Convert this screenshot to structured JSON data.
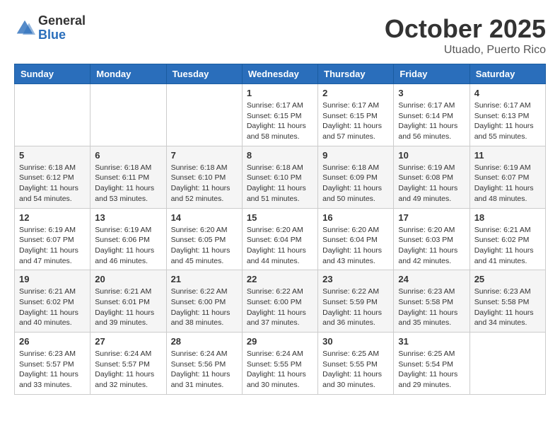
{
  "logo": {
    "general": "General",
    "blue": "Blue"
  },
  "title": "October 2025",
  "location": "Utuado, Puerto Rico",
  "days_of_week": [
    "Sunday",
    "Monday",
    "Tuesday",
    "Wednesday",
    "Thursday",
    "Friday",
    "Saturday"
  ],
  "weeks": [
    [
      {
        "day": "",
        "info": ""
      },
      {
        "day": "",
        "info": ""
      },
      {
        "day": "",
        "info": ""
      },
      {
        "day": "1",
        "info": "Sunrise: 6:17 AM\nSunset: 6:15 PM\nDaylight: 11 hours\nand 58 minutes."
      },
      {
        "day": "2",
        "info": "Sunrise: 6:17 AM\nSunset: 6:15 PM\nDaylight: 11 hours\nand 57 minutes."
      },
      {
        "day": "3",
        "info": "Sunrise: 6:17 AM\nSunset: 6:14 PM\nDaylight: 11 hours\nand 56 minutes."
      },
      {
        "day": "4",
        "info": "Sunrise: 6:17 AM\nSunset: 6:13 PM\nDaylight: 11 hours\nand 55 minutes."
      }
    ],
    [
      {
        "day": "5",
        "info": "Sunrise: 6:18 AM\nSunset: 6:12 PM\nDaylight: 11 hours\nand 54 minutes."
      },
      {
        "day": "6",
        "info": "Sunrise: 6:18 AM\nSunset: 6:11 PM\nDaylight: 11 hours\nand 53 minutes."
      },
      {
        "day": "7",
        "info": "Sunrise: 6:18 AM\nSunset: 6:10 PM\nDaylight: 11 hours\nand 52 minutes."
      },
      {
        "day": "8",
        "info": "Sunrise: 6:18 AM\nSunset: 6:10 PM\nDaylight: 11 hours\nand 51 minutes."
      },
      {
        "day": "9",
        "info": "Sunrise: 6:18 AM\nSunset: 6:09 PM\nDaylight: 11 hours\nand 50 minutes."
      },
      {
        "day": "10",
        "info": "Sunrise: 6:19 AM\nSunset: 6:08 PM\nDaylight: 11 hours\nand 49 minutes."
      },
      {
        "day": "11",
        "info": "Sunrise: 6:19 AM\nSunset: 6:07 PM\nDaylight: 11 hours\nand 48 minutes."
      }
    ],
    [
      {
        "day": "12",
        "info": "Sunrise: 6:19 AM\nSunset: 6:07 PM\nDaylight: 11 hours\nand 47 minutes."
      },
      {
        "day": "13",
        "info": "Sunrise: 6:19 AM\nSunset: 6:06 PM\nDaylight: 11 hours\nand 46 minutes."
      },
      {
        "day": "14",
        "info": "Sunrise: 6:20 AM\nSunset: 6:05 PM\nDaylight: 11 hours\nand 45 minutes."
      },
      {
        "day": "15",
        "info": "Sunrise: 6:20 AM\nSunset: 6:04 PM\nDaylight: 11 hours\nand 44 minutes."
      },
      {
        "day": "16",
        "info": "Sunrise: 6:20 AM\nSunset: 6:04 PM\nDaylight: 11 hours\nand 43 minutes."
      },
      {
        "day": "17",
        "info": "Sunrise: 6:20 AM\nSunset: 6:03 PM\nDaylight: 11 hours\nand 42 minutes."
      },
      {
        "day": "18",
        "info": "Sunrise: 6:21 AM\nSunset: 6:02 PM\nDaylight: 11 hours\nand 41 minutes."
      }
    ],
    [
      {
        "day": "19",
        "info": "Sunrise: 6:21 AM\nSunset: 6:02 PM\nDaylight: 11 hours\nand 40 minutes."
      },
      {
        "day": "20",
        "info": "Sunrise: 6:21 AM\nSunset: 6:01 PM\nDaylight: 11 hours\nand 39 minutes."
      },
      {
        "day": "21",
        "info": "Sunrise: 6:22 AM\nSunset: 6:00 PM\nDaylight: 11 hours\nand 38 minutes."
      },
      {
        "day": "22",
        "info": "Sunrise: 6:22 AM\nSunset: 6:00 PM\nDaylight: 11 hours\nand 37 minutes."
      },
      {
        "day": "23",
        "info": "Sunrise: 6:22 AM\nSunset: 5:59 PM\nDaylight: 11 hours\nand 36 minutes."
      },
      {
        "day": "24",
        "info": "Sunrise: 6:23 AM\nSunset: 5:58 PM\nDaylight: 11 hours\nand 35 minutes."
      },
      {
        "day": "25",
        "info": "Sunrise: 6:23 AM\nSunset: 5:58 PM\nDaylight: 11 hours\nand 34 minutes."
      }
    ],
    [
      {
        "day": "26",
        "info": "Sunrise: 6:23 AM\nSunset: 5:57 PM\nDaylight: 11 hours\nand 33 minutes."
      },
      {
        "day": "27",
        "info": "Sunrise: 6:24 AM\nSunset: 5:57 PM\nDaylight: 11 hours\nand 32 minutes."
      },
      {
        "day": "28",
        "info": "Sunrise: 6:24 AM\nSunset: 5:56 PM\nDaylight: 11 hours\nand 31 minutes."
      },
      {
        "day": "29",
        "info": "Sunrise: 6:24 AM\nSunset: 5:55 PM\nDaylight: 11 hours\nand 30 minutes."
      },
      {
        "day": "30",
        "info": "Sunrise: 6:25 AM\nSunset: 5:55 PM\nDaylight: 11 hours\nand 30 minutes."
      },
      {
        "day": "31",
        "info": "Sunrise: 6:25 AM\nSunset: 5:54 PM\nDaylight: 11 hours\nand 29 minutes."
      },
      {
        "day": "",
        "info": ""
      }
    ]
  ]
}
